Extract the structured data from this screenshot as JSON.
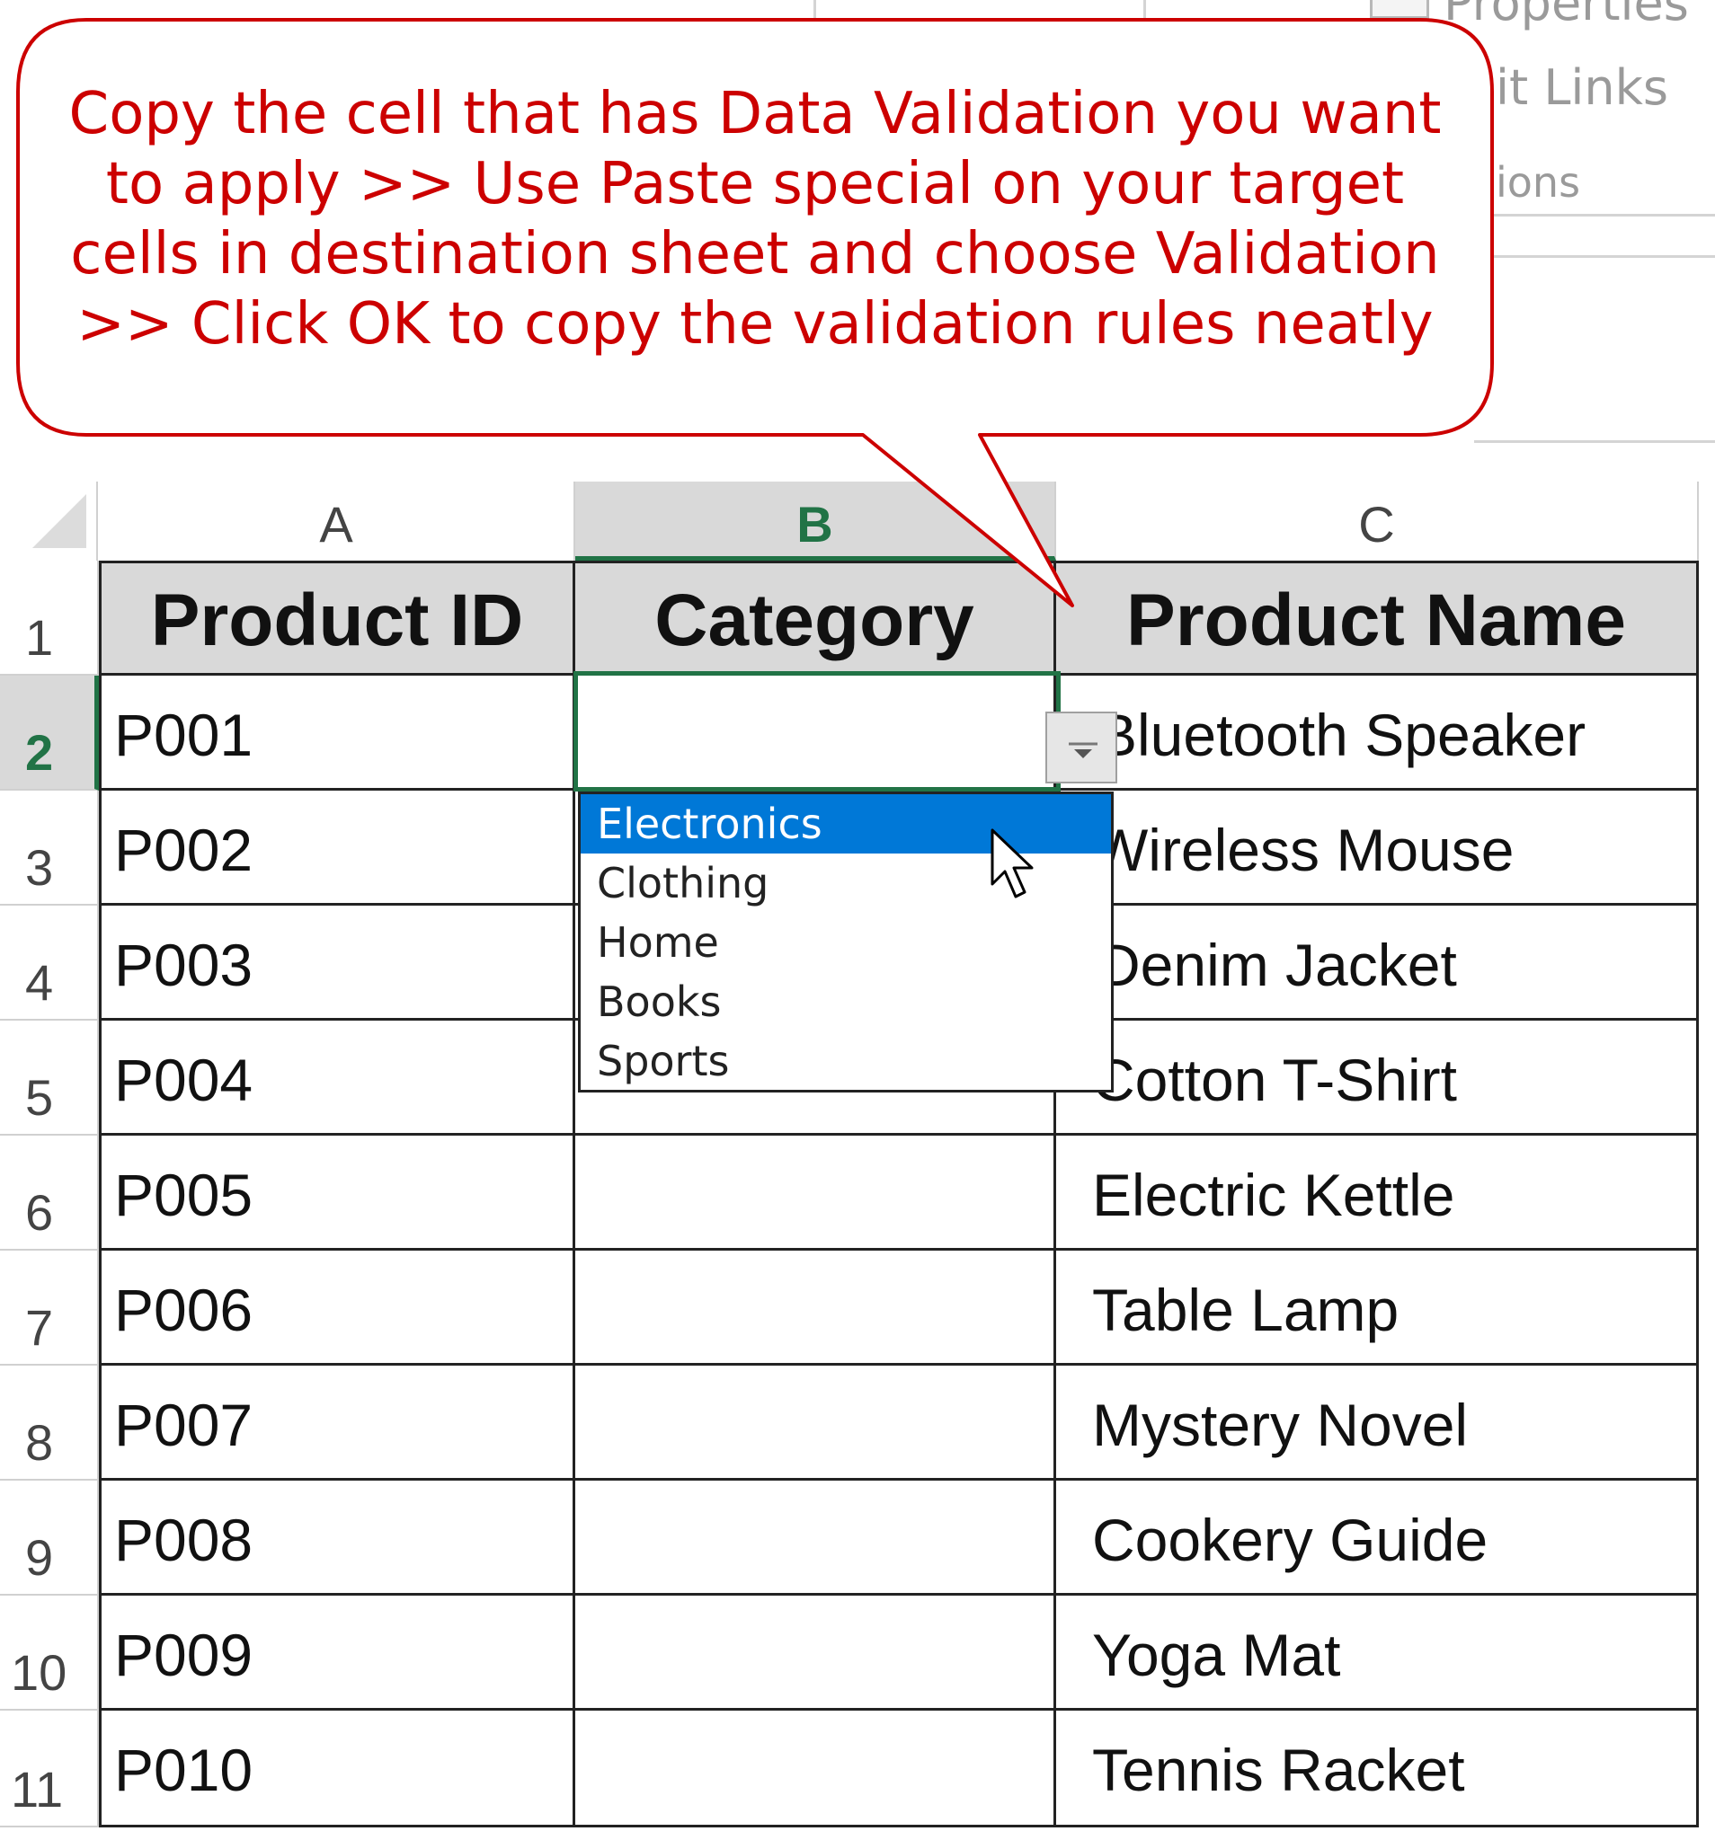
{
  "ribbon": {
    "frag1": "Properties",
    "frag2": "it Links",
    "frag3": "ions"
  },
  "callout": {
    "text": "Copy the cell that has Data Validation you want to apply >> Use Paste special on your target cells in destination sheet and choose Validation >> Click OK to copy the validation rules neatly",
    "color": "#cc0000"
  },
  "columns": [
    "A",
    "B",
    "C"
  ],
  "selected_column": "B",
  "rows": [
    "1",
    "2",
    "3",
    "4",
    "5",
    "6",
    "7",
    "8",
    "9",
    "10",
    "11"
  ],
  "selected_row": "2",
  "table": {
    "headers": [
      "Product ID",
      "Category",
      "Product Name"
    ],
    "product_ids": [
      "P001",
      "P002",
      "P003",
      "P004",
      "P005",
      "P006",
      "P007",
      "P008",
      "P009",
      "P010"
    ],
    "product_names": [
      "Bluetooth Speaker",
      "Wireless Mouse",
      "Denim Jacket",
      "Cotton T-Shirt",
      "Electric Kettle",
      "Table Lamp",
      "Mystery Novel",
      "Cookery Guide",
      "Yoga Mat",
      "Tennis Racket"
    ]
  },
  "dropdown": {
    "options": [
      "Electronics",
      "Clothing",
      "Home",
      "Books",
      "Sports"
    ],
    "highlighted": "Electronics",
    "button_icon": "chevron-down-icon",
    "highlight_color": "#0078d7"
  },
  "accent_color": "#217346"
}
